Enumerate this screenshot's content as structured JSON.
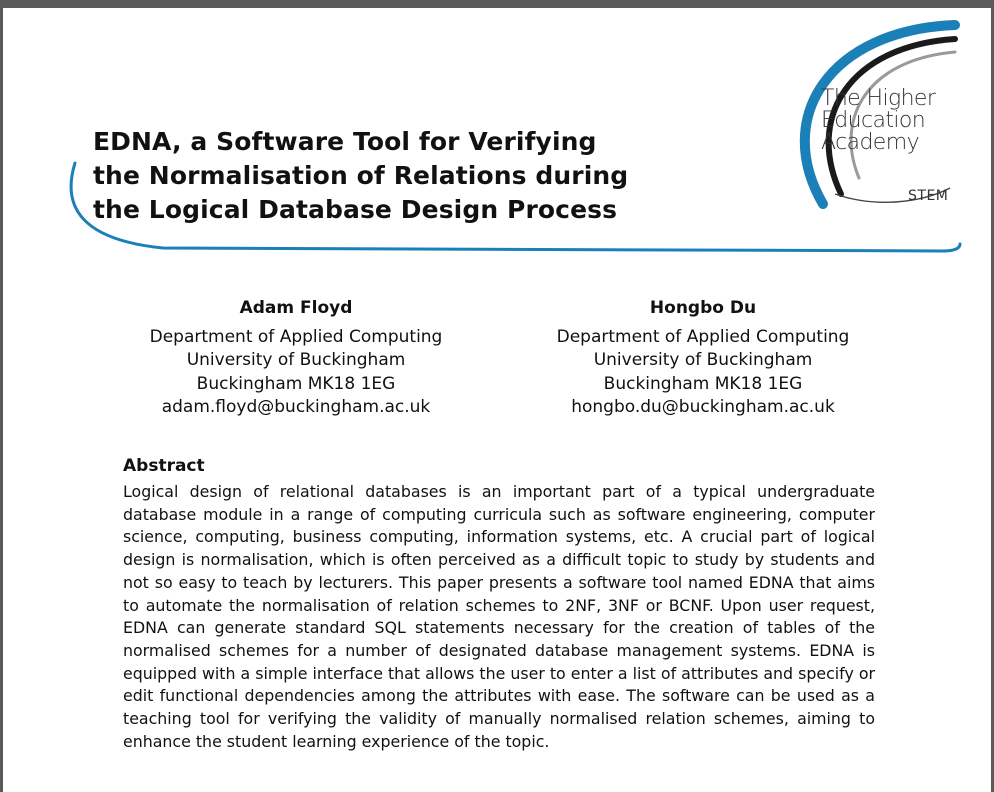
{
  "paper": {
    "title_lines": [
      "EDNA, a Software Tool for Verifying",
      "the Normalisation of Relations during",
      "the Logical Database Design Process"
    ],
    "logo": {
      "lines": [
        "The Higher",
        "Education",
        "Academy"
      ],
      "subtitle": "STEM"
    },
    "authors": [
      {
        "name": "Adam Floyd",
        "department": "Department of Applied Computing",
        "university": "University of Buckingham",
        "address": "Buckingham MK18 1EG",
        "email": "adam.floyd@buckingham.ac.uk"
      },
      {
        "name": "Hongbo Du",
        "department": "Department of Applied Computing",
        "university": "University of Buckingham",
        "address": "Buckingham MK18 1EG",
        "email": "hongbo.du@buckingham.ac.uk"
      }
    ],
    "abstract": {
      "heading": "Abstract",
      "text": "Logical design of relational databases is an important part of a typical undergraduate database module in a range of computing curricula such as software engineering, computer science, computing, business computing, information systems, etc.  A crucial part of logical design is normalisation, which is often perceived as a difficult topic to study by students and not so easy to teach by lecturers.  This paper presents a software tool named EDNA that aims to automate the normalisation of relation schemes to 2NF, 3NF or BCNF.  Upon user request, EDNA can generate standard SQL statements necessary for the creation of tables of the normalised schemes for a number of designated database management systems.  EDNA is equipped with a simple interface that allows the user to enter a list of attributes and specify or edit functional dependencies among the attributes with ease.  The software can be used as a teaching tool for verifying the validity of manually normalised relation schemes, aiming to enhance the student learning experience of the topic."
    },
    "colors": {
      "accent_blue": "#1b7fb8",
      "dark_arc": "#1a1a1a",
      "grey_arc": "#9a9a9a"
    }
  }
}
